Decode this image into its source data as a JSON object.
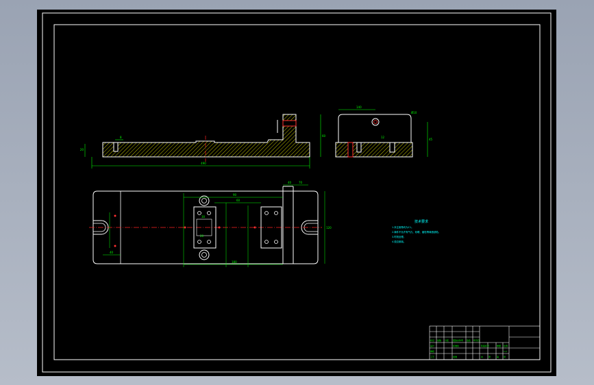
{
  "viewport": {
    "background": "#a8b1c0",
    "sheet_color": "#000000",
    "frame_color": "#ffffff",
    "geometry_color": "#ffffff",
    "hatch_color": "#d4d400",
    "dimension_color": "#00ff00",
    "centerline_color": "#ff2020",
    "note_color": "#00ffff"
  },
  "drawing": {
    "front_view": {
      "overall_length": "490",
      "height_left": "20",
      "slot_dim": "8",
      "post_height": "60"
    },
    "side_view": {
      "width": "140",
      "hole_dim": "Ø10",
      "height": "45",
      "slot_dim": "12"
    },
    "plan_view": {
      "dim_top_1": "90",
      "dim_top_2": "60",
      "dim_top_3": "40",
      "dim_top_4": "70",
      "dim_side": "120",
      "dim_small_1": "30",
      "dim_small_2": "20",
      "dim_bottom_1": "40",
      "dim_bottom_2": "180"
    },
    "notes": {
      "title": "技术要求",
      "lines": [
        "1.未注倒角均为C1。",
        "2.铸件不允许有气孔、砂眼、缩松等铸造缺陷。",
        "3.时效处理。",
        "4.锐边倒钝。"
      ]
    },
    "title_block": {
      "cells": [
        "标记",
        "处数",
        "分区",
        "更改文件号",
        "签名",
        "年月日",
        "设计",
        "标准化",
        "阶段标记",
        "重量",
        "比例",
        "审核",
        "工艺",
        "批准",
        "共",
        "张",
        "第",
        "张",
        "1:2"
      ]
    }
  }
}
